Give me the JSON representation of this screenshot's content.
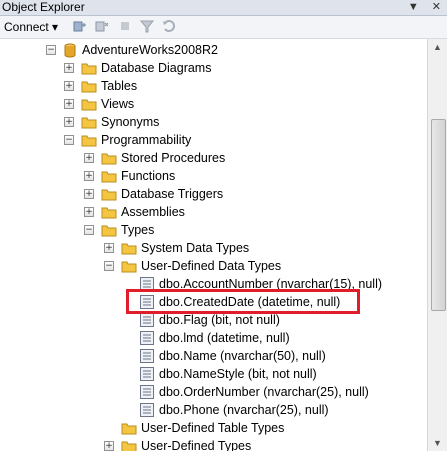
{
  "panel": {
    "title": "Object Explorer",
    "title_buttons": [
      "▼",
      "✕"
    ]
  },
  "toolbar": {
    "connect_label": "Connect ▾"
  },
  "tree": {
    "db": "AdventureWorks2008R2",
    "database_diagrams": "Database Diagrams",
    "tables": "Tables",
    "views": "Views",
    "synonyms": "Synonyms",
    "programmability": "Programmability",
    "stored_procedures": "Stored Procedures",
    "functions": "Functions",
    "database_triggers": "Database Triggers",
    "assemblies": "Assemblies",
    "types": "Types",
    "system_data_types": "System Data Types",
    "user_defined_data_types": "User-Defined Data Types",
    "udt_items": [
      "dbo.AccountNumber (nvarchar(15), null)",
      "dbo.CreatedDate (datetime, null)",
      "dbo.Flag (bit, not null)",
      "dbo.lmd (datetime, null)",
      "dbo.Name (nvarchar(50), null)",
      "dbo.NameStyle (bit, not null)",
      "dbo.OrderNumber (nvarchar(25), null)",
      "dbo.Phone (nvarchar(25), null)"
    ],
    "user_defined_table_types": "User-Defined Table Types",
    "user_defined_types": "User-Defined Types"
  },
  "colors": {
    "highlight": "#e01e2b",
    "folder": "#f5c542",
    "db": "#e3a52b"
  }
}
